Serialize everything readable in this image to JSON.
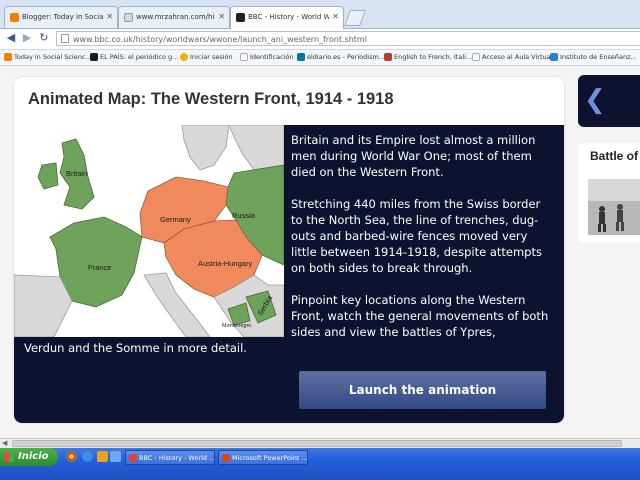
{
  "browser": {
    "tabs": [
      {
        "label": "Blogger: Today in Social Scien...",
        "icon": "blogger-icon",
        "color": "#f57d00",
        "active": false
      },
      {
        "label": "www.mrzahran.com/history...",
        "icon": "page-icon",
        "color": "#cfd8e4",
        "active": false
      },
      {
        "label": "BBC - History - World Wars:...",
        "icon": "bbc-icon",
        "color": "#222222",
        "active": true
      }
    ],
    "url": "www.bbc.co.uk/history/worldwars/wwone/launch_ani_western_front.shtml",
    "bookmarks": [
      {
        "label": "Today in Social Scienc...",
        "icon": "blogger-icon",
        "color": "#f57d00"
      },
      {
        "label": "EL PAÍS: el periódico g...",
        "icon": "elpais-icon",
        "color": "#1a1a1a"
      },
      {
        "label": "Iniciar sesión",
        "icon": "sun-icon",
        "color": "#e8b400"
      },
      {
        "label": "Identificación",
        "icon": "page-icon",
        "color": "#cccccc"
      },
      {
        "label": "eldiario.es - Periodism...",
        "icon": "eldiario-icon",
        "color": "#0077aa"
      },
      {
        "label": "English to French, Itali...",
        "icon": "translate-icon",
        "color": "#c0392b"
      },
      {
        "label": "Acceso al Aula Virtual",
        "icon": "page-icon",
        "color": "#cccccc"
      },
      {
        "label": "Instituto de Enseñanz...",
        "icon": "p-icon",
        "color": "#2a7fd4"
      }
    ]
  },
  "main": {
    "title": "Animated Map: The Western Front, 1914 - 1918",
    "paragraphs": [
      "Britain and its Empire lost almost a million men during World War One; most of them died on the Western Front.",
      "Stretching 440 miles from the Swiss border to the North Sea, the line of trenches, dug-outs and barbed-wire fences moved very little between 1914-1918, despite attempts on both sides to break through.",
      "Pinpoint key locations along the Western Front, watch the general movements of both sides and view the battles of Ypres,",
      "Verdun and the Somme in more detail."
    ],
    "launch_label": "Launch the animation",
    "map_labels": {
      "britain": "Britain",
      "france": "France",
      "germany": "Germany",
      "russia": "Russia",
      "austria": "Austria-Hungary",
      "serbia": "Serbia",
      "montenegro": "Montenegro"
    },
    "colors": {
      "allies": "#6fa25a",
      "central": "#f08a5d",
      "neutral": "#d8d8d8",
      "sea": "#ffffff",
      "navy": "#0d1230"
    }
  },
  "side": {
    "battle_title": "Battle of"
  },
  "taskbar": {
    "start_label": "Inicio",
    "tasks": [
      {
        "label": "BBC - History - World ...",
        "icon": "chrome-icon",
        "color": "#dd4433"
      },
      {
        "label": "Microsoft PowerPoint ...",
        "icon": "powerpoint-icon",
        "color": "#d24726"
      }
    ]
  }
}
